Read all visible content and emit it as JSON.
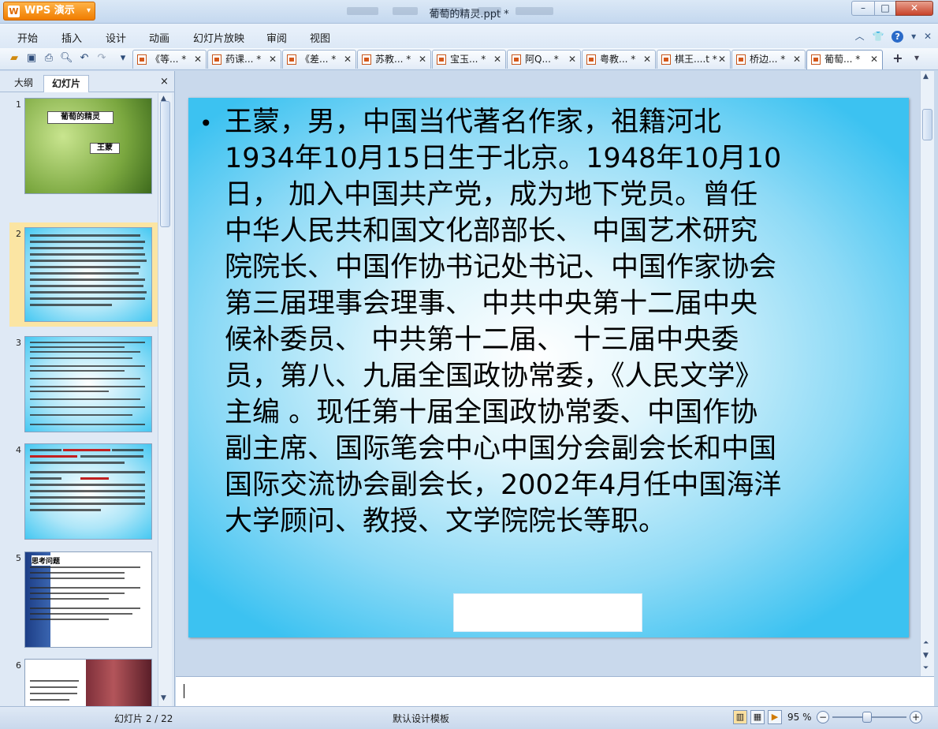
{
  "app": {
    "name": "WPS 演示",
    "document_title": "葡萄的精灵.ppt *"
  },
  "window_controls": {
    "minimize": "–",
    "maximize": "□",
    "close": "✕"
  },
  "menu": [
    "开始",
    "插入",
    "设计",
    "动画",
    "幻灯片放映",
    "审阅",
    "视图"
  ],
  "tabs": [
    {
      "label": "《等... *",
      "active": false
    },
    {
      "label": "药课... *",
      "active": false
    },
    {
      "label": "《差... *",
      "active": false
    },
    {
      "label": "苏教... *",
      "active": false
    },
    {
      "label": "宝玉... *",
      "active": false
    },
    {
      "label": "阿Q... *",
      "active": false
    },
    {
      "label": "粤教... *",
      "active": false
    },
    {
      "label": "棋王....t *",
      "active": false
    },
    {
      "label": "桥边... *",
      "active": false
    },
    {
      "label": "葡萄... *",
      "active": true
    }
  ],
  "left_panel": {
    "tab_outline": "大纲",
    "tab_slides": "幻灯片",
    "close": "×",
    "thumbnails": [
      {
        "number": "1",
        "title": "葡萄的精灵",
        "author": "王蒙"
      },
      {
        "number": "2",
        "selected": true
      },
      {
        "number": "3"
      },
      {
        "number": "4"
      },
      {
        "number": "5",
        "title": "思考问题"
      },
      {
        "number": "6"
      }
    ]
  },
  "slide": {
    "bullet": "•",
    "text_lines": [
      "王蒙，男，中国当代著名作家，祖籍河北",
      "1934年10月15日生于北京。1948年10月10",
      "日， 加入中国共产党，成为地下党员。曾任",
      "中华人民共和国文化部部长、 中国艺术研究",
      "院院长、中国作协书记处书记、中国作家协会",
      "第三届理事会理事、 中共中央第十二届中央",
      "候补委员、 中共第十二届、 十三届中央委",
      "员，第八、九届全国政协常委，《人民文学》",
      "主编 。现任第十届全国政协常委、中国作协",
      "副主席、国际笔会中心中国分会副会长和中国",
      "国际交流协会副会长，2002年4月任中国海洋",
      "大学顾问、教授、文学院院长等职。"
    ]
  },
  "status": {
    "slide_indicator": "幻灯片 2 / 22",
    "template": "默认设计模板",
    "zoom": "95 %",
    "zoom_minus": "−",
    "zoom_plus": "+"
  },
  "colors": {
    "slide_edge": "#3cc2f1",
    "slide_center": "#ffffff",
    "wps_orange": "#f07d00",
    "selected_thumb": "#fbe5a3"
  }
}
